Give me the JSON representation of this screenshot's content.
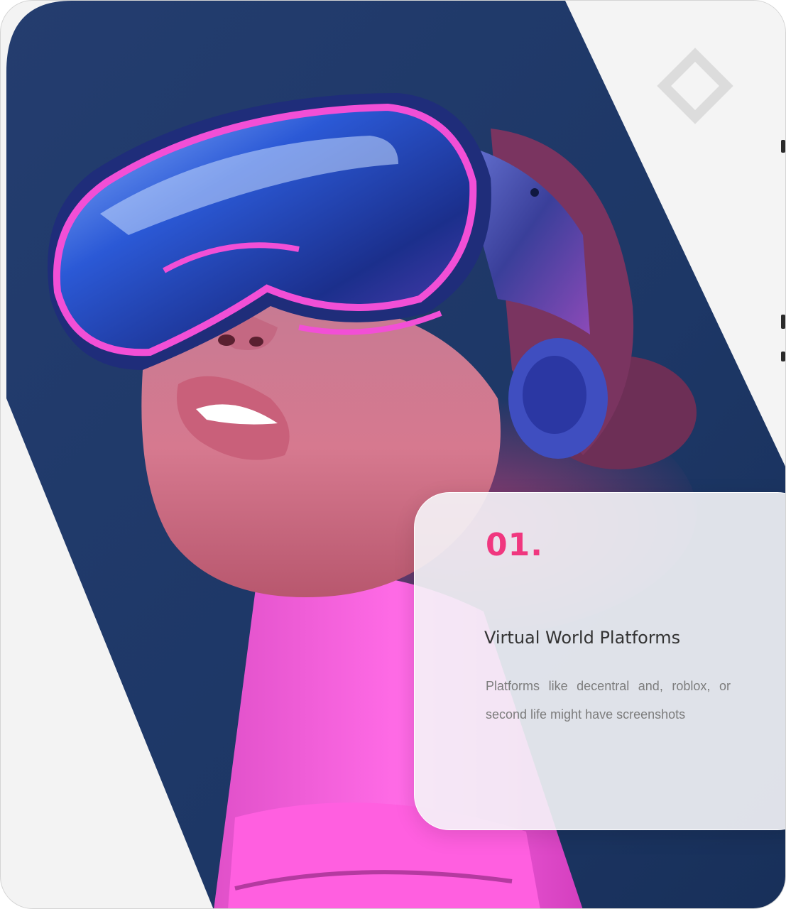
{
  "colors": {
    "accent": "#f0377f",
    "navy": "#1f3a6e",
    "skin": "#d9728a",
    "magenta": "#f24fd6",
    "background": "#f3f3f3"
  },
  "decor": {
    "shape": "diamond-outline-icon"
  },
  "card": {
    "number": "01.",
    "title": "Virtual World Platforms",
    "description": "Platforms like decentral and, roblox, or second life might have screenshots"
  },
  "image": {
    "subject": "vr-headset-photo"
  }
}
